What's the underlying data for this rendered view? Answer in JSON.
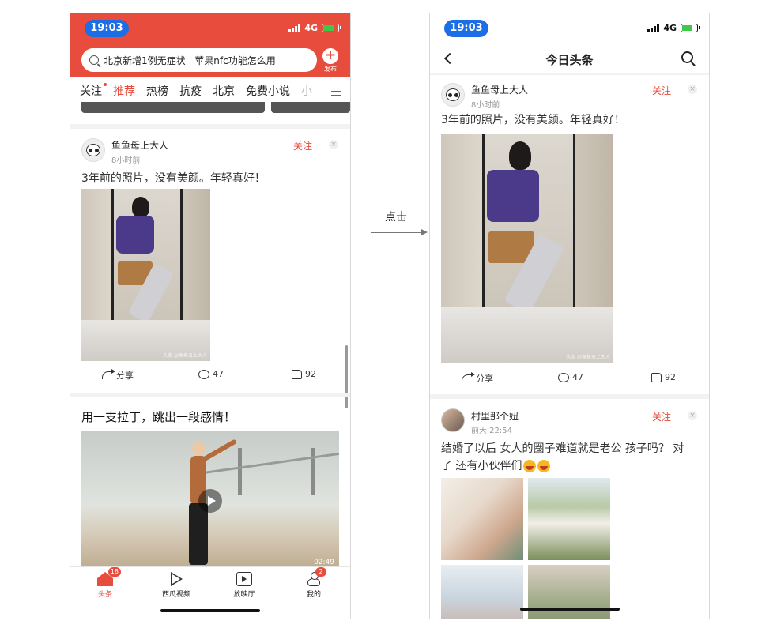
{
  "left": {
    "status": {
      "time": "19:03",
      "network": "4G"
    },
    "search": {
      "text": "北京新增1例无症状 | 苹果nfc功能怎么用"
    },
    "publish_label": "发布",
    "tabs": [
      {
        "label": "关注",
        "dot": true
      },
      {
        "label": "推荐",
        "active": true
      },
      {
        "label": "热榜"
      },
      {
        "label": "抗疫"
      },
      {
        "label": "北京"
      },
      {
        "label": "免费小说"
      },
      {
        "label": "小"
      }
    ],
    "post": {
      "author": "鱼鱼母上大人",
      "time": "8小时前",
      "follow": "关注",
      "close": "×",
      "text": "3年前的照片，没有美颜。年轻真好！",
      "watermark": "头条 @鱼鱼母上大人",
      "share": "分享",
      "comments": "47",
      "likes": "92"
    },
    "video": {
      "title": "用一支拉丁，跳出一段感情！",
      "duration": "02:49"
    },
    "nav": [
      {
        "label": "头条",
        "badge": "18",
        "active": true
      },
      {
        "label": "西瓜视频"
      },
      {
        "label": "放映厅"
      },
      {
        "label": "我的",
        "badge": "2"
      }
    ]
  },
  "arrow": {
    "label": "点击"
  },
  "right": {
    "status": {
      "time": "19:03",
      "network": "4G"
    },
    "title": "今日头条",
    "post": {
      "author": "鱼鱼母上大人",
      "time": "8小时前",
      "follow": "关注",
      "close": "×",
      "text": "3年前的照片，没有美颜。年轻真好！",
      "watermark": "头条 @鱼鱼母上大人",
      "share": "分享",
      "comments": "47",
      "likes": "92"
    },
    "post2": {
      "author": "村里那个妞",
      "time": "前天 22:54",
      "follow": "关注",
      "close": "×",
      "text_line1": "结婚了以后 女人的圈子难道就是老公 孩子吗？ 对",
      "text_line2": "了 还有小伙伴们"
    }
  },
  "colors": {
    "brand_red": "#e84c3d",
    "time_pill": "#1b6ee6"
  }
}
